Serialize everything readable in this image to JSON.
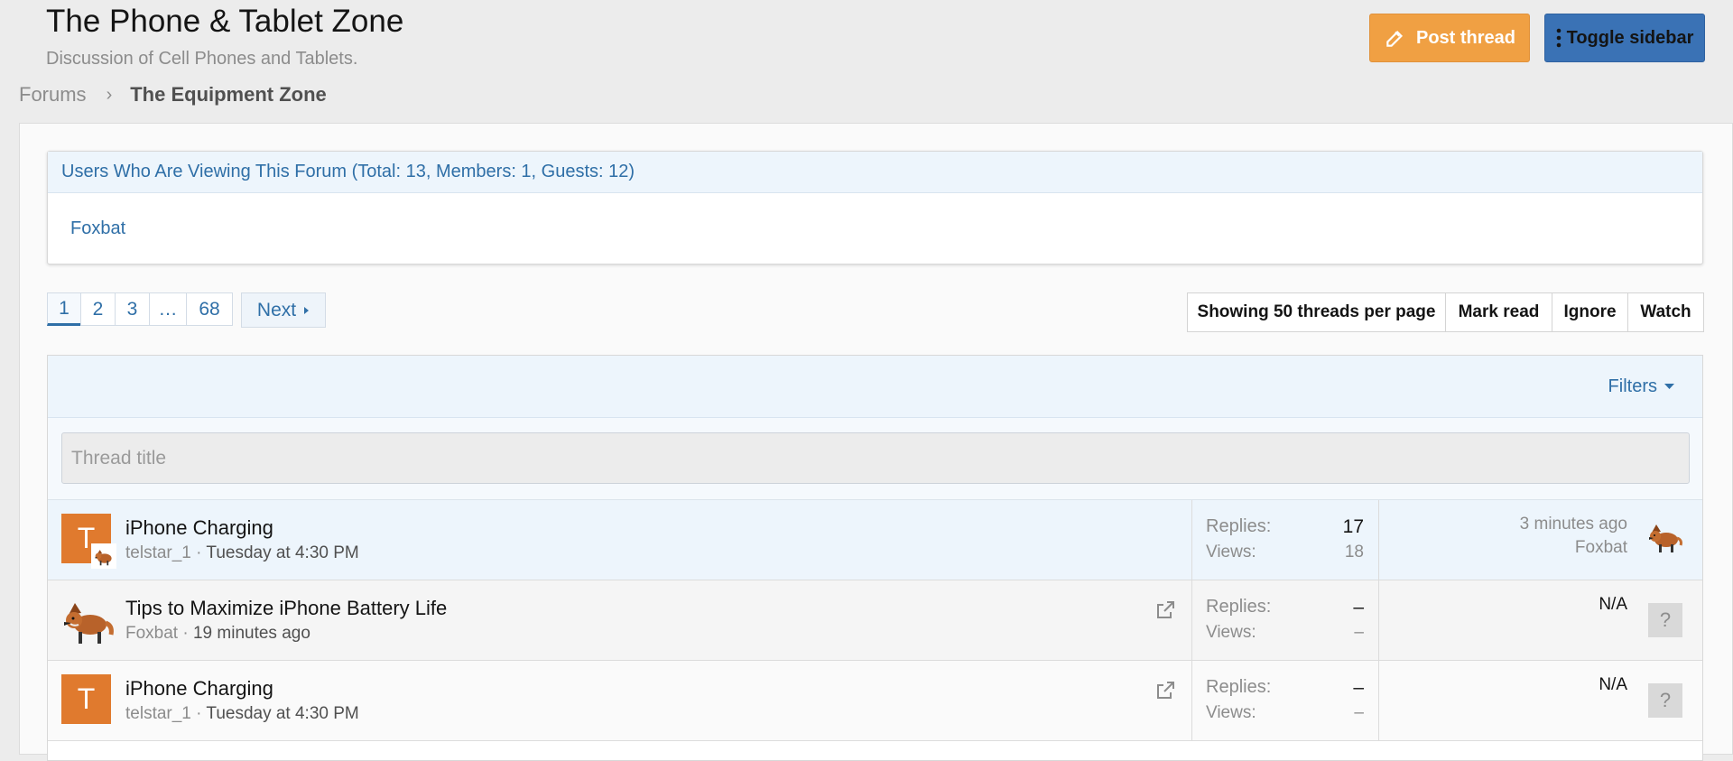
{
  "header": {
    "title": "The Phone & Tablet Zone",
    "description": "Discussion of Cell Phones and Tablets.",
    "post_thread_label": "Post thread",
    "toggle_sidebar_label": "Toggle sidebar"
  },
  "breadcrumb": {
    "root": "Forums",
    "current": "The Equipment Zone"
  },
  "viewers": {
    "heading": "Users Who Are Viewing This Forum (Total: 13, Members: 1, Guests: 12)",
    "users": [
      "Foxbat"
    ]
  },
  "pagination": {
    "pages": [
      "1",
      "2",
      "3",
      "…",
      "68"
    ],
    "current": "1",
    "next_label": "Next"
  },
  "forum_actions": {
    "per_page_label": "Showing 50 threads per page",
    "mark_read_label": "Mark read",
    "ignore_label": "Ignore",
    "watch_label": "Watch"
  },
  "filters": {
    "label": "Filters",
    "title_placeholder": "Thread title"
  },
  "threads": [
    {
      "avatar_letter": "T",
      "title": "iPhone Charging",
      "author": "telstar_1",
      "date": "Tuesday at 4:30 PM",
      "replies_label": "Replies:",
      "replies": "17",
      "views_label": "Views:",
      "views": "18",
      "last_time": "3 minutes ago",
      "last_user": "Foxbat"
    },
    {
      "title": "Tips to Maximize iPhone Battery Life",
      "author": "Foxbat",
      "date": "19 minutes ago",
      "replies_label": "Replies:",
      "replies": "–",
      "views_label": "Views:",
      "views": "–",
      "last_text": "N/A",
      "unknown_avatar": "?"
    },
    {
      "avatar_letter": "T",
      "title": "iPhone Charging",
      "author": "telstar_1",
      "date": "Tuesday at 4:30 PM",
      "replies_label": "Replies:",
      "replies": "–",
      "views_label": "Views:",
      "views": "–",
      "last_text": "N/A",
      "unknown_avatar": "?"
    }
  ]
}
